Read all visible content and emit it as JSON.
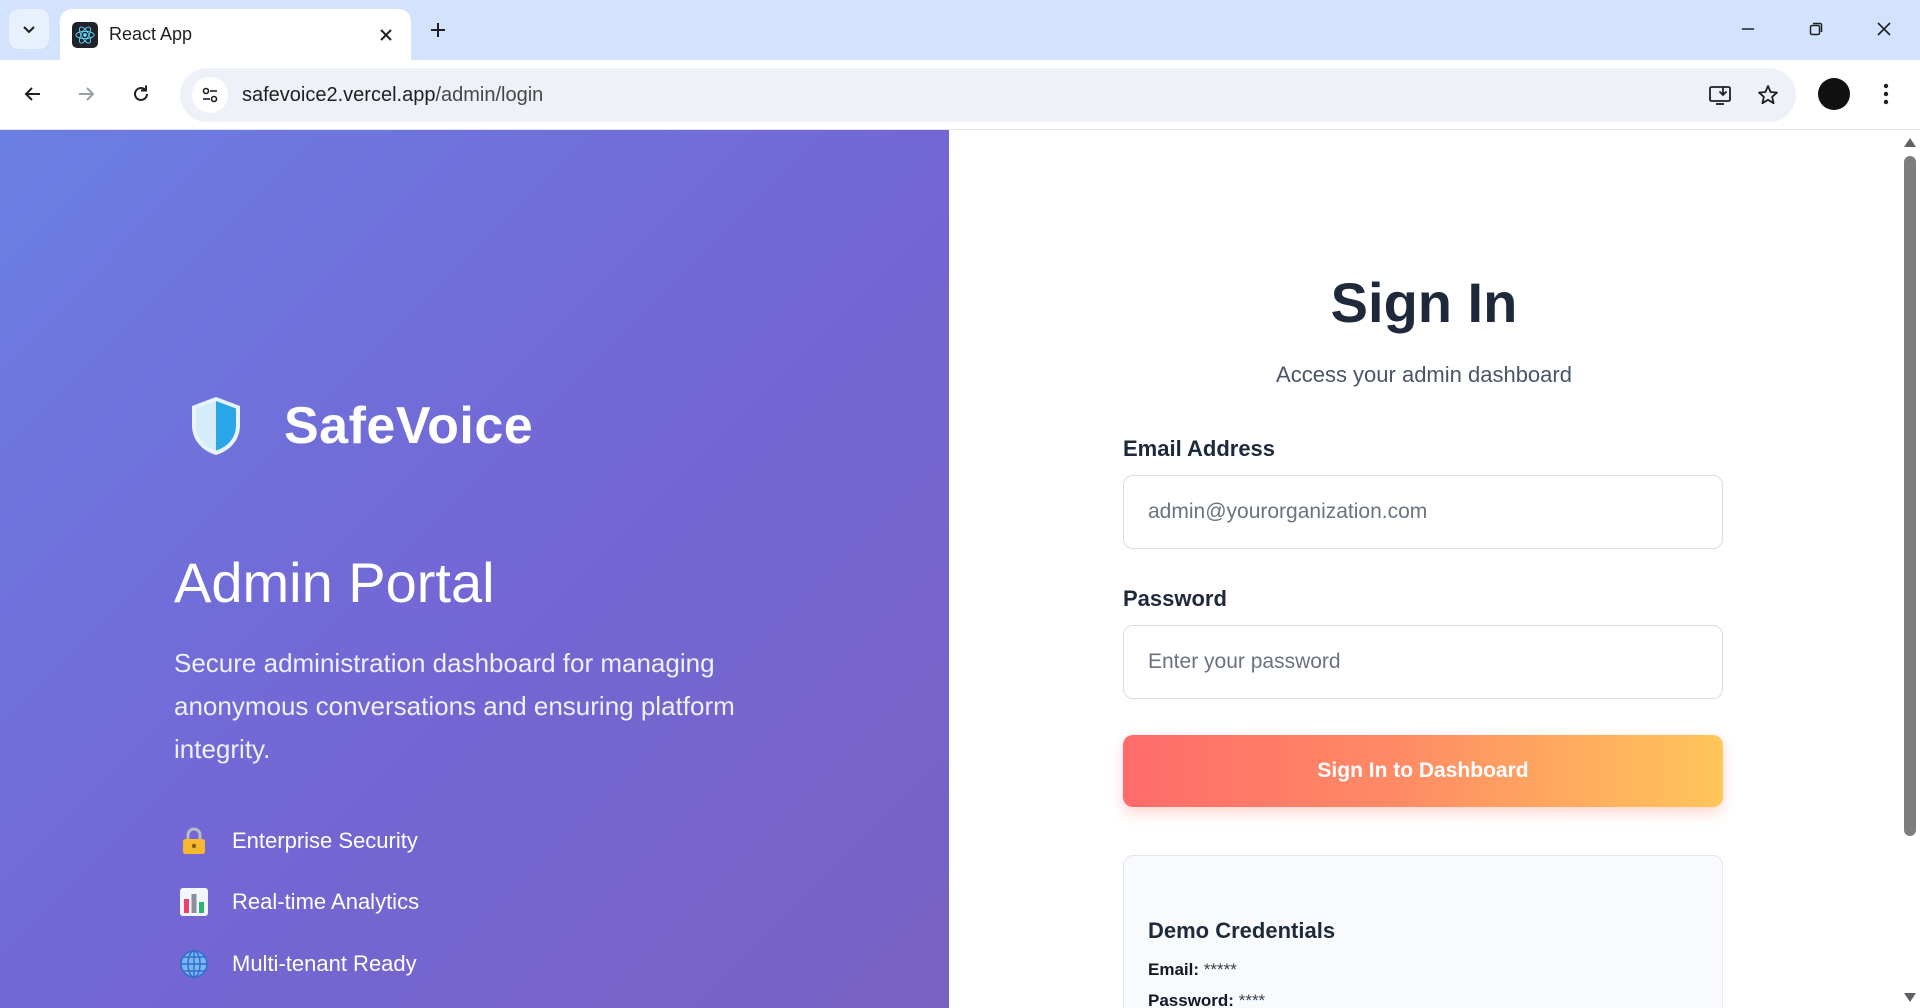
{
  "browser": {
    "tab_title": "React App",
    "url_host": "safevoice2.vercel.app",
    "url_path": "/admin/login",
    "icons": {
      "tab_search": "chevron-down-icon",
      "favicon": "react-logo-icon",
      "close": "close-icon",
      "new_tab": "plus-icon",
      "back": "arrow-left-icon",
      "forward": "arrow-right-icon",
      "reload": "reload-icon",
      "site_info": "tune-icon",
      "install": "install-app-icon",
      "bookmark": "star-icon",
      "menu": "kebab-icon"
    }
  },
  "hero": {
    "brand_name": "SafeVoice",
    "title": "Admin Portal",
    "description": "Secure administration dashboard for managing anonymous conversations and ensuring platform integrity.",
    "features": [
      {
        "label": "Enterprise Security",
        "icon": "lock-icon"
      },
      {
        "label": "Real-time Analytics",
        "icon": "bar-chart-icon"
      },
      {
        "label": "Multi-tenant Ready",
        "icon": "globe-icon"
      }
    ],
    "gradient": [
      "#6b7fe3",
      "#7367d5",
      "#7862c2"
    ]
  },
  "form": {
    "title": "Sign In",
    "subtitle": "Access your admin dashboard",
    "email_label": "Email Address",
    "email_placeholder": "admin@yourorganization.com",
    "email_value": "",
    "password_label": "Password",
    "password_placeholder": "Enter your password",
    "password_value": "",
    "submit_label": "Sign In to Dashboard",
    "submit_gradient": [
      "#ff6b6b",
      "#ffc65a"
    ]
  },
  "demo": {
    "title": "Demo Credentials",
    "email_key": "Email:",
    "email_value": " *****",
    "password_key": "Password:",
    "password_value": " ****"
  }
}
